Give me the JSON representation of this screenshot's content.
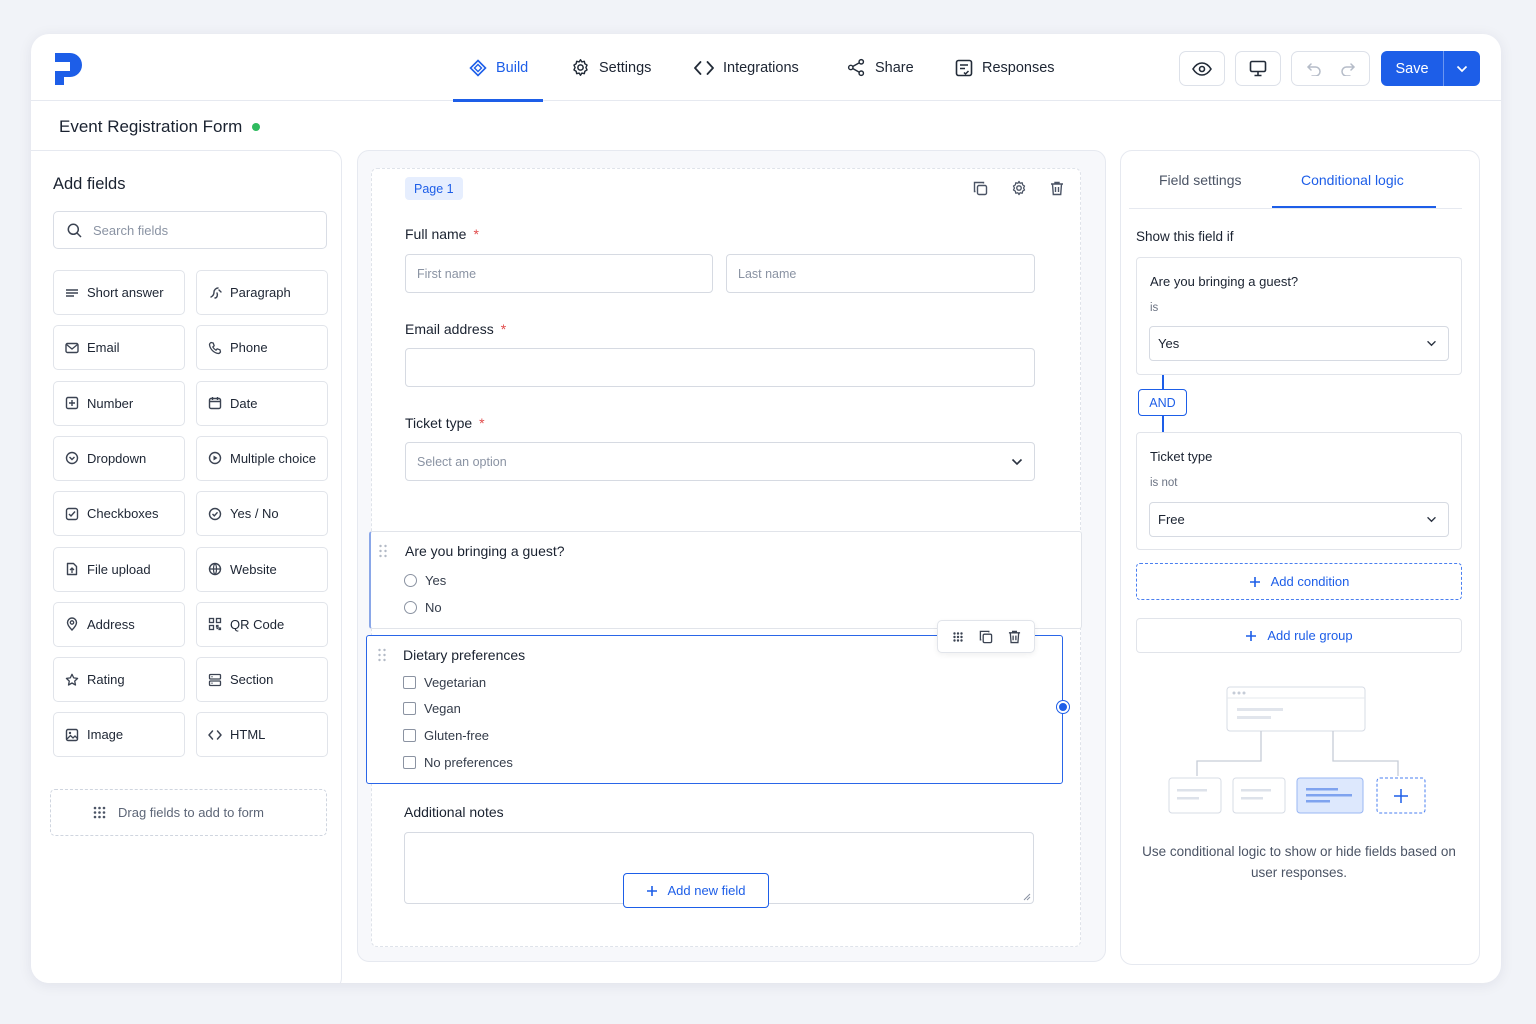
{
  "nav": {
    "tabs": [
      {
        "label": "Build",
        "icon": "build-icon",
        "active": true
      },
      {
        "label": "Settings",
        "icon": "gear-icon"
      },
      {
        "label": "Integrations",
        "icon": "code-icon"
      },
      {
        "label": "Share",
        "icon": "share-icon"
      },
      {
        "label": "Responses",
        "icon": "responses-icon"
      }
    ],
    "save_label": "Save",
    "accent": "#1d5ee8"
  },
  "form": {
    "title": "Event Registration Form",
    "status_color": "#2fbb5f"
  },
  "sidebar": {
    "title": "Add fields",
    "search_placeholder": "Search fields",
    "fields": [
      {
        "label": "Short answer",
        "icon": "short-answer-icon"
      },
      {
        "label": "Paragraph",
        "icon": "paragraph-icon"
      },
      {
        "label": "Email",
        "icon": "email-icon"
      },
      {
        "label": "Phone",
        "icon": "phone-icon"
      },
      {
        "label": "Number",
        "icon": "number-icon"
      },
      {
        "label": "Date",
        "icon": "calendar-icon"
      },
      {
        "label": "Dropdown",
        "icon": "dropdown-icon"
      },
      {
        "label": "Multiple choice",
        "icon": "multiple-choice-icon"
      },
      {
        "label": "Checkboxes",
        "icon": "checkbox-icon"
      },
      {
        "label": "Yes / No",
        "icon": "yes-no-icon"
      },
      {
        "label": "File upload",
        "icon": "file-upload-icon"
      },
      {
        "label": "Website",
        "icon": "globe-icon"
      },
      {
        "label": "Address",
        "icon": "location-icon"
      },
      {
        "label": "QR Code",
        "icon": "qr-code-icon"
      },
      {
        "label": "Rating",
        "icon": "star-icon"
      },
      {
        "label": "Section",
        "icon": "section-icon"
      },
      {
        "label": "Image",
        "icon": "image-icon"
      },
      {
        "label": "HTML",
        "icon": "html-icon"
      }
    ],
    "drag_hint": "Drag fields to add to form"
  },
  "canvas": {
    "page_label": "Page 1",
    "full_name": {
      "label": "Full name",
      "required": "*",
      "first_placeholder": "First name",
      "last_placeholder": "Last name"
    },
    "email": {
      "label": "Email address",
      "required": "*"
    },
    "ticket": {
      "label": "Ticket type",
      "required": "*",
      "placeholder": "Select an option"
    },
    "guest": {
      "label": "Are you bringing a guest?",
      "options": [
        "Yes",
        "No"
      ]
    },
    "dietary": {
      "label": "Dietary preferences",
      "options": [
        "Vegetarian",
        "Vegan",
        "Gluten-free",
        "No preferences"
      ]
    },
    "notes": {
      "label": "Additional notes"
    },
    "add_field": "Add new field"
  },
  "logic": {
    "tabs": [
      "Field settings",
      "Conditional logic"
    ],
    "show_if": "Show this field if",
    "conditions": [
      {
        "field": "Are you bringing a guest?",
        "operator": "is",
        "value": "Yes"
      },
      {
        "field": "Ticket type",
        "operator": "is not",
        "value": "Free"
      }
    ],
    "joiner": "AND",
    "add_condition": "Add condition",
    "add_rule_group": "Add rule group",
    "note": "Use conditional logic to show or hide fields based on user responses."
  }
}
